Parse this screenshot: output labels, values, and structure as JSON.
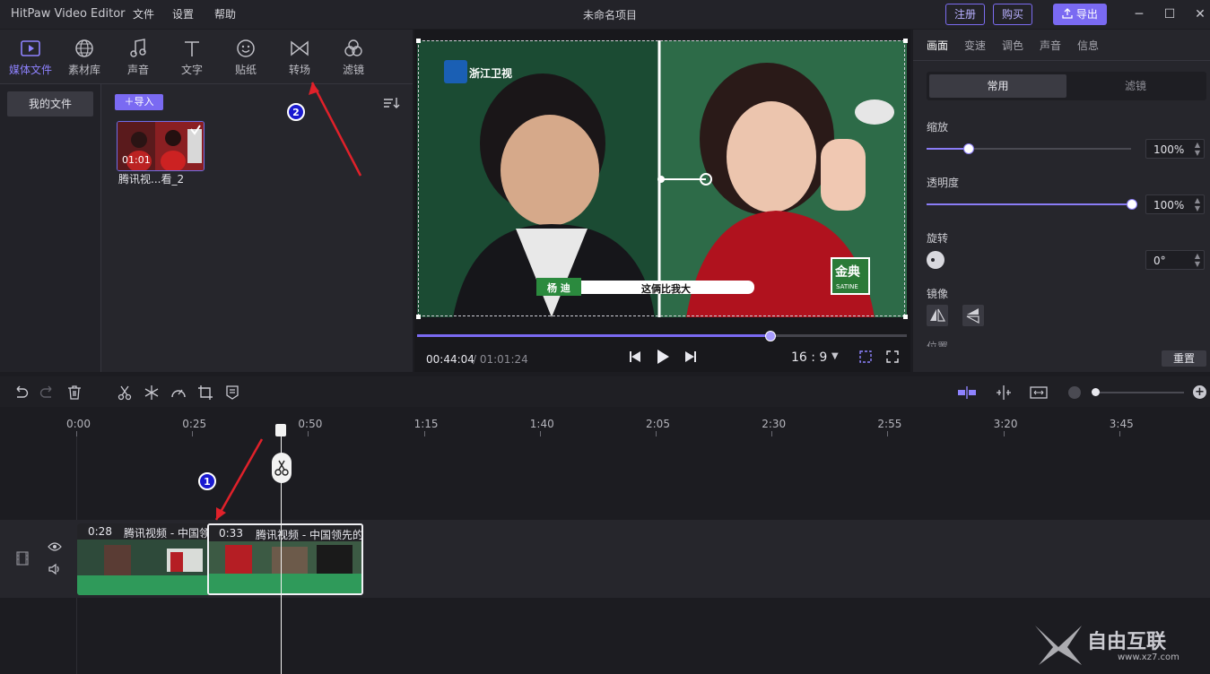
{
  "app": {
    "name": "HitPaw Video Editor",
    "project_title": "未命名项目"
  },
  "menu": [
    "文件",
    "设置",
    "帮助"
  ],
  "header_buttons": {
    "register": "注册",
    "buy": "购买",
    "export": "导出"
  },
  "left_tabs": [
    {
      "label": "媒体文件",
      "icon": "media-icon",
      "active": true
    },
    {
      "label": "素材库",
      "icon": "globe-icon"
    },
    {
      "label": "声音",
      "icon": "music-icon"
    },
    {
      "label": "文字",
      "icon": "text-icon"
    },
    {
      "label": "贴纸",
      "icon": "sticker-icon"
    },
    {
      "label": "转场",
      "icon": "transition-icon"
    },
    {
      "label": "滤镜",
      "icon": "filter-icon"
    }
  ],
  "media": {
    "my_files": "我的文件",
    "import": "导入",
    "item": {
      "duration": "01:01",
      "name": "腾讯视...看_2"
    }
  },
  "video_overlay": {
    "channel_logo": "浙江卫视",
    "name_tag": "杨 迪",
    "caption": "这俩比我大",
    "brand": "金典",
    "brand_sub": "SATINE"
  },
  "player": {
    "current": "00:44:04",
    "total": "/ 01:01:24",
    "progress": 0.72,
    "aspect": "16 : 9"
  },
  "right_tabs": [
    {
      "label": "画面",
      "active": true
    },
    {
      "label": "变速"
    },
    {
      "label": "调色"
    },
    {
      "label": "声音"
    },
    {
      "label": "信息"
    }
  ],
  "segments": {
    "normal": "常用",
    "filter": "滤镜"
  },
  "properties": {
    "scale_label": "缩放",
    "scale_value": "100%",
    "scale_level": 0.2,
    "opacity_label": "透明度",
    "opacity_value": "100%",
    "opacity_level": 1.0,
    "rotate_label": "旋转",
    "rotate_value": "0°",
    "mirror_label": "镜像",
    "position_label": "位置",
    "reset": "重置"
  },
  "timeline": {
    "ticks": [
      "0:00",
      "0:25",
      "0:50",
      "1:15",
      "1:40",
      "2:05",
      "2:30",
      "2:55",
      "3:20",
      "3:45"
    ],
    "clips": [
      {
        "duration": "0:28",
        "title": "腾讯视频 - 中国领先的"
      },
      {
        "duration": "0:33",
        "title": "腾讯视频 - 中国领先的"
      }
    ]
  },
  "annotations": {
    "badge1": "1",
    "badge2": "2"
  },
  "watermark": {
    "brand": "自由互联",
    "url": "www.xz7.com"
  },
  "colors": {
    "accent": "#7a6af2",
    "audio": "#2f9a5a",
    "badge": "#1a1ad0",
    "arrow": "#e0212a"
  }
}
